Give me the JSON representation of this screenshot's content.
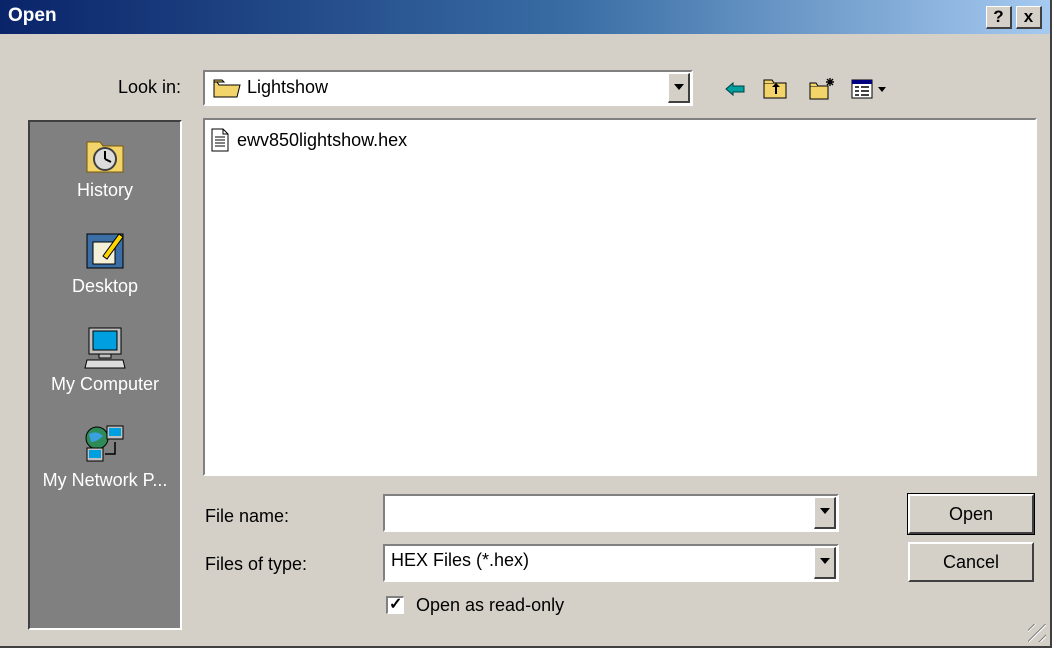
{
  "window": {
    "title": "Open",
    "help_label": "?",
    "close_label": "x"
  },
  "look_in": {
    "label": "Look in:",
    "value": "Lightshow"
  },
  "toolbar": {
    "back_icon": "back-arrow-icon",
    "up_icon": "up-folder-icon",
    "new_folder_icon": "new-folder-icon",
    "view_icon": "view-menu-icon"
  },
  "places": [
    {
      "label": "History",
      "icon": "history-icon"
    },
    {
      "label": "Desktop",
      "icon": "desktop-icon"
    },
    {
      "label": "My Computer",
      "icon": "my-computer-icon"
    },
    {
      "label": "My Network P...",
      "icon": "network-places-icon"
    }
  ],
  "files": [
    {
      "name": "ewv850lightshow.hex",
      "icon": "text-file-icon"
    }
  ],
  "file_name": {
    "label": "File name:",
    "value": ""
  },
  "file_type": {
    "label": "Files of type:",
    "value": "HEX Files (*.hex)"
  },
  "read_only": {
    "label": "Open as read-only",
    "checked": true
  },
  "buttons": {
    "open": "Open",
    "cancel": "Cancel"
  },
  "colors": {
    "title_start": "#0a246a",
    "title_end": "#a6caf0",
    "face": "#d4d0c8",
    "places_bg": "#808080"
  }
}
